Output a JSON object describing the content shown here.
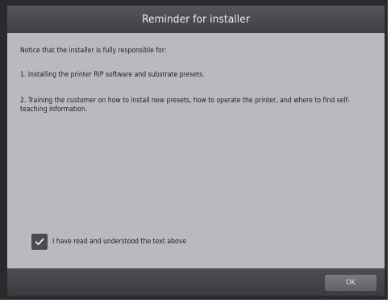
{
  "dialog": {
    "title": "Reminder for installer",
    "paragraphs": [
      "Notice that the installer is fully responsible for:",
      "1. Installing the printer RIP software and substrate presets.",
      "2. Training the customer on how to install new presets, how to operate the printer, and where to find self-teaching information."
    ],
    "checkbox": {
      "label": "I have read and understood the text above",
      "checked": true
    },
    "ok_label": "OK"
  },
  "colors": {
    "frame": "#2a2a2c",
    "content_bg": "#b9babd",
    "titlebar": "#4a4b4f",
    "checkbox_bg": "#4b4c50",
    "button_bg": "#6d6e72"
  },
  "icons": {
    "checkbox_mark": "checkmark-icon"
  }
}
